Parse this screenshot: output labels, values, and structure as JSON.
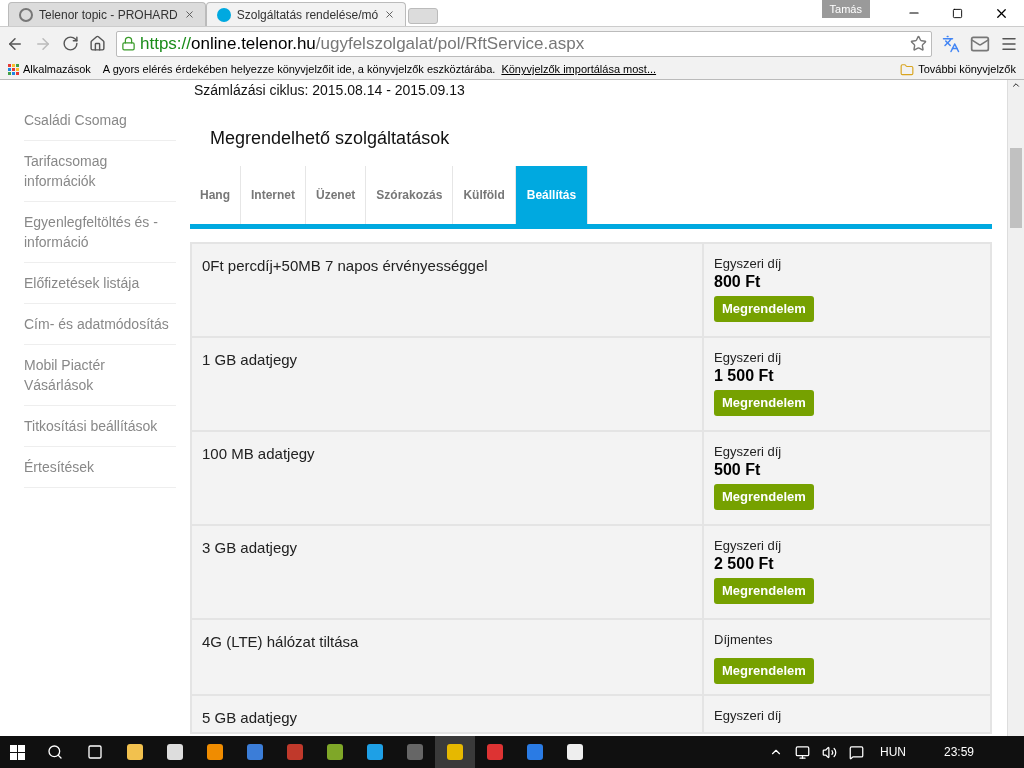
{
  "browser": {
    "tabs": [
      {
        "title": "Telenor topic - PROHARD",
        "selected": false
      },
      {
        "title": "Szolgáltatás rendelése/mó",
        "selected": true
      }
    ],
    "user": "Tamás",
    "url": {
      "scheme": "https://",
      "host": "online.telenor.hu",
      "path": "/ugyfelszolgalat/pol/RftService.aspx"
    },
    "bookmarks": {
      "apps": "Alkalmazások",
      "hint": "A gyors elérés érdekében helyezze könyvjelzőit ide, a könyvjelzők eszköztárába.",
      "import_link": "Könyvjelzők importálása most...",
      "other": "További könyvjelzők"
    }
  },
  "page": {
    "billing_cycle": "Számlázási ciklus: 2015.08.14 - 2015.09.13",
    "sidebar": [
      "Családi Csomag",
      "Tarifacsomag információk",
      "Egyenlegfeltöltés és - információ",
      "Előfizetések listája",
      "Cím- és adatmódosítás",
      "Mobil Piactér Vásárlások",
      "Titkosítási beállítások",
      "Értesítések"
    ],
    "heading": "Megrendelhető szolgáltatások",
    "tabs": [
      {
        "label": "Hang",
        "selected": false
      },
      {
        "label": "Internet",
        "selected": false
      },
      {
        "label": "Üzenet",
        "selected": false
      },
      {
        "label": "Szórakozás",
        "selected": false
      },
      {
        "label": "Külföld",
        "selected": false
      },
      {
        "label": "Beállítás",
        "selected": true
      }
    ],
    "services": [
      {
        "name": "0Ft percdíj+50MB 7 napos érvényességgel",
        "kind": "priced",
        "fee_label": "Egyszeri díj",
        "price": "800 Ft",
        "button": "Megrendelem"
      },
      {
        "name": "1 GB adatjegy",
        "kind": "priced",
        "fee_label": "Egyszeri díj",
        "price": "1 500 Ft",
        "button": "Megrendelem"
      },
      {
        "name": "100 MB adatjegy",
        "kind": "priced",
        "fee_label": "Egyszeri díj",
        "price": "500 Ft",
        "button": "Megrendelem"
      },
      {
        "name": "3 GB adatjegy",
        "kind": "priced",
        "fee_label": "Egyszeri díj",
        "price": "2 500 Ft",
        "button": "Megrendelem"
      },
      {
        "name": "4G (LTE) hálózat tiltása",
        "kind": "free",
        "fee_label": "Díjmentes",
        "button": "Megrendelem"
      },
      {
        "name": "5 GB adatjegy",
        "kind": "cut",
        "fee_label": "Egyszeri díj"
      }
    ]
  },
  "taskbar": {
    "language": "HUN",
    "time": "23:59"
  }
}
